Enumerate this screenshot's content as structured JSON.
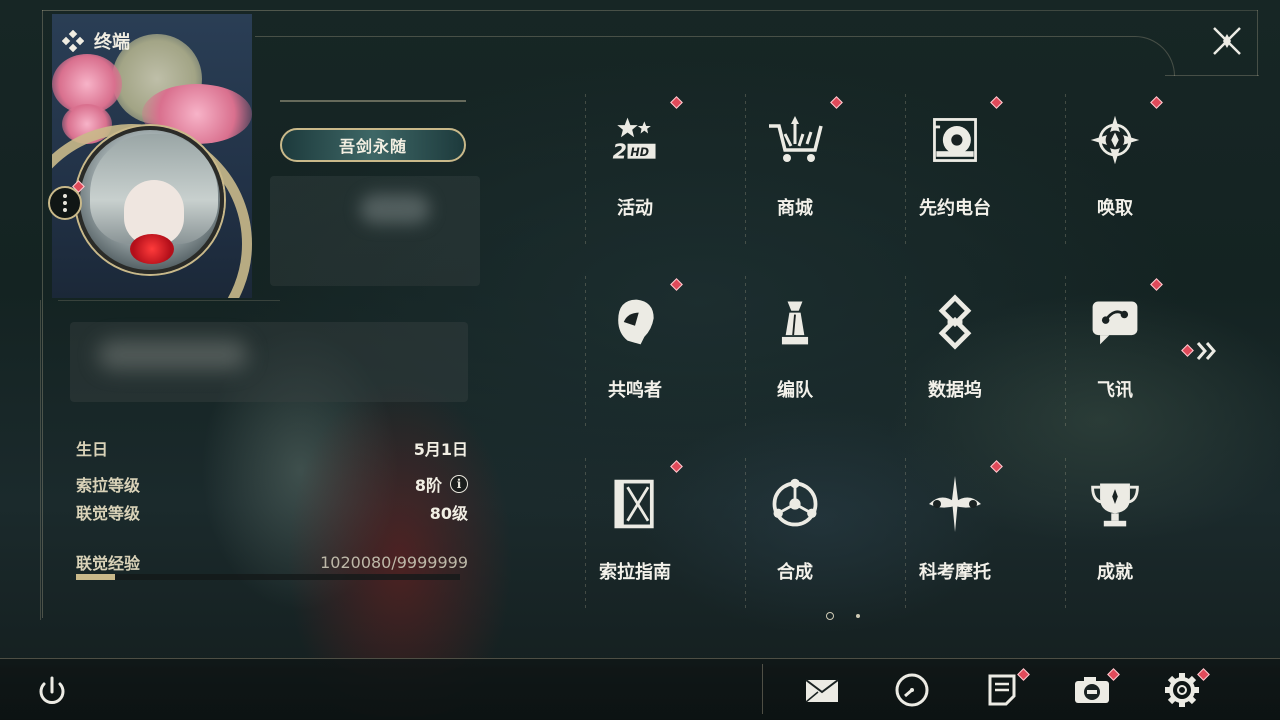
{
  "window": {
    "title": "终端",
    "title_icon": "diamond-cluster-icon"
  },
  "close": {
    "icon": "close-x-icon"
  },
  "profile": {
    "title_plate": "吾剑永随",
    "menu_icon": "more-dots-icon",
    "stats": [
      {
        "key": "生日",
        "value": "5月1日"
      },
      {
        "key": "索拉等级",
        "value": "8阶",
        "info_icon": "info-icon"
      },
      {
        "key": "联觉等级",
        "value": "80级"
      },
      {
        "key": "联觉经验",
        "value": "1020080/9999999"
      }
    ],
    "xp_progress": 0.102
  },
  "menu": [
    {
      "label": "活动",
      "icon": "event-stars-icon",
      "badge": true
    },
    {
      "label": "商城",
      "icon": "shop-cart-icon",
      "badge": true
    },
    {
      "label": "先约电台",
      "icon": "radio-record-icon",
      "badge": true
    },
    {
      "label": "唤取",
      "icon": "compass-star-icon",
      "badge": true
    },
    {
      "label": "共鸣者",
      "icon": "character-head-icon",
      "badge": true
    },
    {
      "label": "编队",
      "icon": "chess-king-icon",
      "badge": false
    },
    {
      "label": "数据坞",
      "icon": "data-dock-icon",
      "badge": false
    },
    {
      "label": "飞讯",
      "icon": "chat-bubble-icon",
      "badge": true
    },
    {
      "label": "索拉指南",
      "icon": "guide-book-icon",
      "badge": true
    },
    {
      "label": "合成",
      "icon": "synthesis-orbit-icon",
      "badge": false
    },
    {
      "label": "科考摩托",
      "icon": "motorbike-icon",
      "badge": true
    },
    {
      "label": "成就",
      "icon": "trophy-icon",
      "badge": false
    }
  ],
  "pagination": {
    "next_icon": "double-chevron-right-icon",
    "current": 1,
    "total": 2
  },
  "bottom": {
    "power_icon": "power-icon",
    "tools": [
      {
        "icon": "mail-icon",
        "badge": false
      },
      {
        "icon": "clock-icon",
        "badge": false
      },
      {
        "icon": "notes-icon",
        "badge": true
      },
      {
        "icon": "camera-icon",
        "badge": true
      },
      {
        "icon": "settings-gear-icon",
        "badge": true
      }
    ]
  },
  "colors": {
    "accent_gold": "#c9b98a",
    "badge_red": "#e04a5a",
    "text": "#f3f1ea"
  }
}
